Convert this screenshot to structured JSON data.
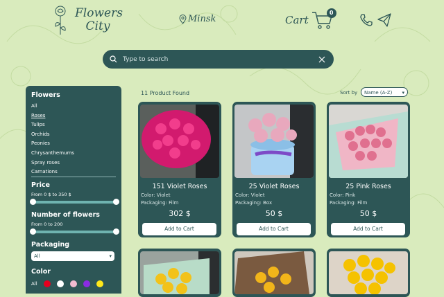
{
  "header": {
    "logo_line1": "Flowers",
    "logo_line2": "City",
    "city": "Minsk",
    "cart_label": "Cart",
    "cart_count": "0"
  },
  "search": {
    "placeholder": "Type to search"
  },
  "sidebar": {
    "flowers_title": "Flowers",
    "categories": [
      "All",
      "Roses",
      "Tulips",
      "Orchids",
      "Peonies",
      "Chrysanthemums",
      "Spray roses",
      "Carnations"
    ],
    "active_category": "Roses",
    "price_title": "Price",
    "price_range": "From 0 $ to 350 $",
    "price_min": 0,
    "price_max": 350,
    "count_title": "Number of flowers",
    "count_range": "From 0 to 200",
    "count_min": 0,
    "count_max": 200,
    "packaging_title": "Packaging",
    "packaging_value": "All",
    "color_title": "Color",
    "color_all": "All",
    "colors": [
      "#e6001f",
      "#ffffff",
      "#f2bcd0",
      "#8a2be2",
      "#ffe81a"
    ]
  },
  "products_header": {
    "found": "11 Product Found",
    "sort_label": "Sort by",
    "sort_value": "Name (A-Z)"
  },
  "products": [
    {
      "name": "151 Violet Roses",
      "color": "Color: Violet",
      "packaging": "Packaging: Film",
      "price": "302 $",
      "button": "Add to Cart"
    },
    {
      "name": "25 Violet Roses",
      "color": "Color: Violet",
      "packaging": "Packaging: Box",
      "price": "50 $",
      "button": "Add to Cart"
    },
    {
      "name": "25 Pink Roses",
      "color": "Color: Pink",
      "packaging": "Packaging: Film",
      "price": "50 $",
      "button": "Add to Cart"
    }
  ]
}
